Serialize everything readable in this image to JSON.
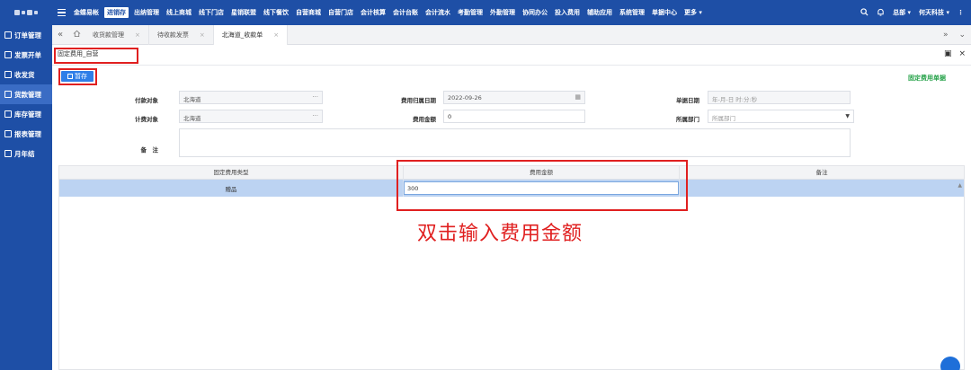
{
  "topnav": {
    "items": [
      "金蝶易帐",
      "进销存",
      "出纳管理",
      "线上商城",
      "线下门店",
      "星销联盟",
      "线下餐饮",
      "自营商城",
      "自营门店",
      "会计核算",
      "会计台账",
      "会计流水",
      "考勤管理",
      "外勤管理",
      "协同办公",
      "投入费用",
      "辅助应用",
      "系统管理",
      "单据中心",
      "更多 ▾"
    ],
    "user": "总部 ▾",
    "company": "何天科技 ▾",
    "more": "⋮"
  },
  "sidebar": {
    "items": [
      "订单管理",
      "发票开单",
      "收发货",
      "货款管理",
      "库存管理",
      "报表管理",
      "月年结"
    ]
  },
  "tabs": {
    "items": [
      "收货款管理",
      "待收款发票",
      "北海道_收款单"
    ]
  },
  "form": {
    "title": "固定费用_自营",
    "save_label": "暂存",
    "doc_type": "固定费用单据",
    "fields": {
      "payee_label": "付款对象",
      "payee_value": "北海道",
      "expense_date_label": "费用归属日期",
      "expense_date_value": "2022-09-26",
      "doc_date_label": "单据日期",
      "doc_date_placeholder": "年-月-日 时:分:秒",
      "cost_obj_label": "计费对象",
      "cost_obj_value": "北海道",
      "amount_label": "费用金额",
      "amount_value": "0",
      "dept_label": "所属部门",
      "dept_placeholder": "所属部门",
      "remark_label": "备　注"
    }
  },
  "grid": {
    "headers": [
      "固定费用类型",
      "费用金额",
      "备注"
    ],
    "row": {
      "type": "赠品",
      "amount": "300",
      "remark": ""
    }
  },
  "hint": "双击输入费用金额",
  "colors": {
    "nav": "#1e4fa6",
    "accent": "#2f7ee8",
    "highlight": "#e02020",
    "doc_type": "#24a148"
  }
}
